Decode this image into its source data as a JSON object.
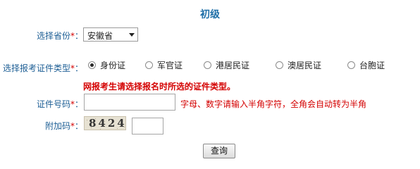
{
  "title": "初级",
  "province": {
    "label": "选择省份",
    "required_mark": "*",
    "colon": "：",
    "selected": "安徽省"
  },
  "id_type": {
    "label": "选择报考证件类型",
    "required_mark": "*",
    "colon": "：",
    "options": [
      "身份证",
      "军官证",
      "港居民证",
      "澳居民证",
      "台胞证"
    ],
    "selected_index": 0
  },
  "warning": "网报考生请选择报名时所选的证件类型。",
  "id_number": {
    "label": "证件号码",
    "required_mark": "*",
    "colon": "：",
    "value": "",
    "hint": "字母、数字请输入半角字符，全角会自动转为半角"
  },
  "captcha": {
    "label": "附加码",
    "required_mark": "*",
    "colon": "：",
    "code": "8424",
    "value": ""
  },
  "submit_label": "查询",
  "colors": {
    "label": "#1e5f95",
    "title": "#1f6fa8",
    "required": "#d40000",
    "warning": "#d40000"
  }
}
